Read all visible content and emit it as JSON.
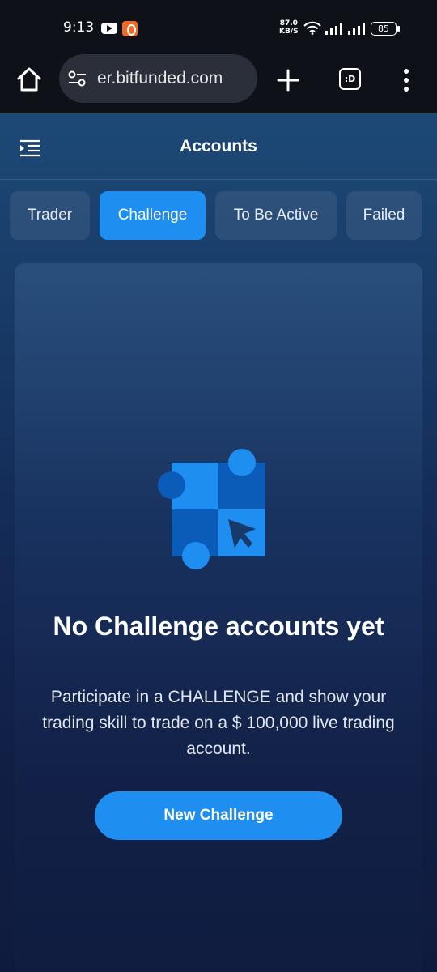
{
  "status_bar": {
    "time": "9:13",
    "speed_value": "87.0",
    "speed_unit": "KB/S",
    "battery": "85"
  },
  "browser": {
    "url": "er.bitfunded.com",
    "tabs_label": ":D"
  },
  "header": {
    "title": "Accounts"
  },
  "tabs": [
    {
      "label": "Trader",
      "active": false
    },
    {
      "label": "Challenge",
      "active": true
    },
    {
      "label": "To Be Active",
      "active": false
    },
    {
      "label": "Failed",
      "active": false
    }
  ],
  "empty_state": {
    "title": "No Challenge accounts yet",
    "description": "Participate in a CHALLENGE and show your trading skill to trade on a $ 100,000 live trading account.",
    "button_label": "New Challenge"
  },
  "colors": {
    "accent": "#1f8ef1",
    "dark_tile": "#0b5cb8",
    "browser_bg": "#0e1117"
  },
  "icons": {
    "home": "home-icon",
    "site_settings": "tune-icon",
    "new_tab": "plus-icon",
    "tabs": "tabs-icon",
    "menu": "more-vert-icon",
    "sidebar": "menu-indent-icon"
  }
}
